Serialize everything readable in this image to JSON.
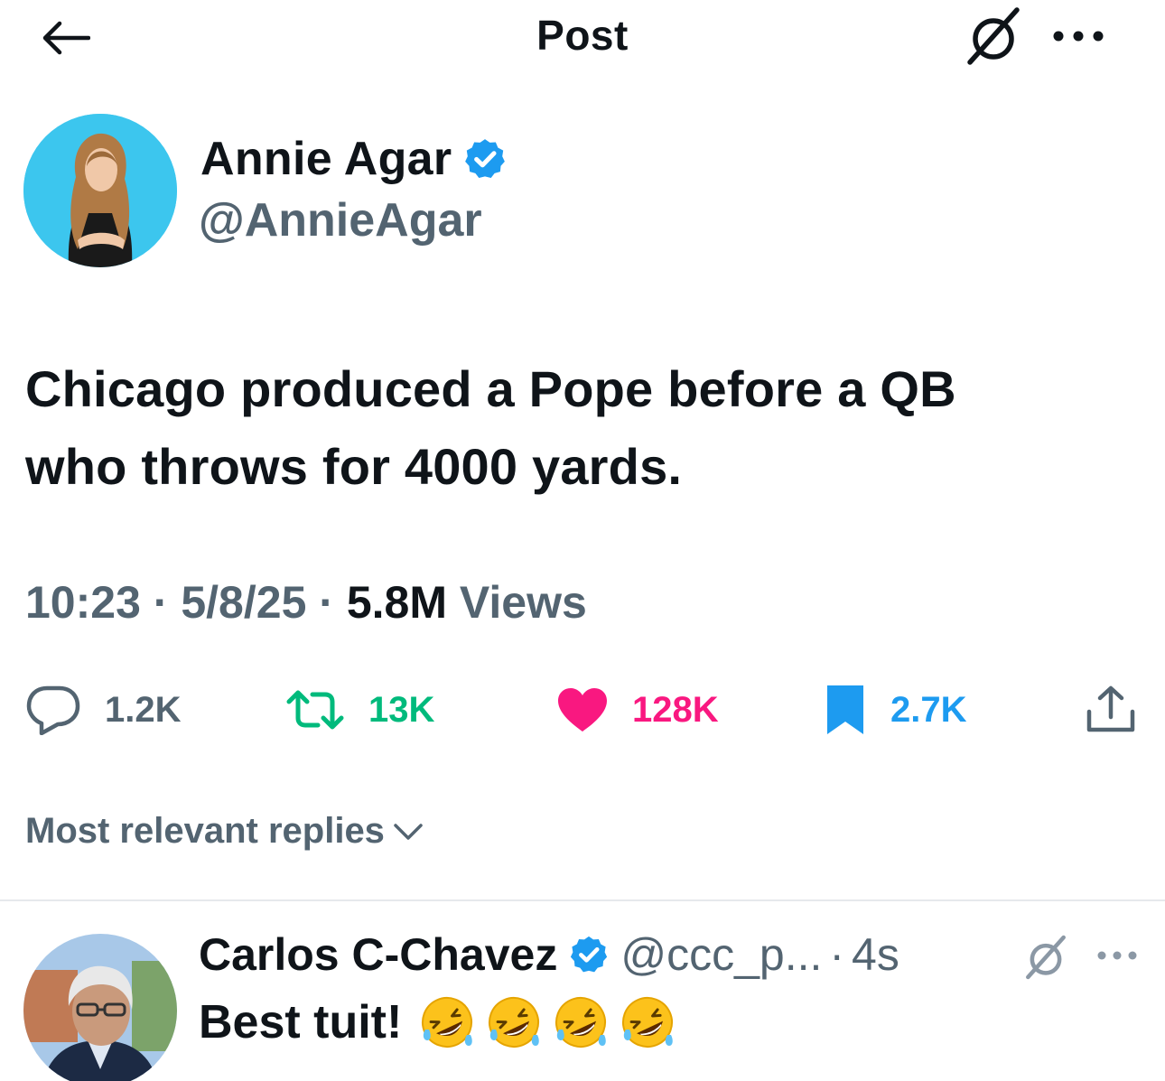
{
  "header": {
    "title": "Post",
    "back_icon": "arrow-left-icon",
    "grok_icon": "grok-icon",
    "more_icon": "more-horizontal-icon"
  },
  "post": {
    "author": {
      "name": "Annie Agar",
      "handle": "@AnnieAgar",
      "verified": true,
      "avatar_bg": "#3cc6ee"
    },
    "text_line1": "Chicago produced a Pope before a QB",
    "text_line2": "who throws for 4000 yards.",
    "time": "10:23",
    "date": "5/8/25",
    "separator": "·",
    "views_count": "5.8M",
    "views_label": "Views",
    "stats": {
      "replies": "1.2K",
      "reposts": "13K",
      "likes": "128K",
      "bookmarks": "2.7K"
    }
  },
  "replies_section": {
    "sort_label": "Most relevant replies"
  },
  "reply": {
    "name": "Carlos C-Chavez",
    "handle": "@ccc_p...",
    "separator": "·",
    "time": "4s",
    "text": "Best tuit!",
    "emoji_count": 4,
    "emoji_name": "rolling-on-the-floor-laughing"
  },
  "colors": {
    "text": "#0f1419",
    "secondary": "#536471",
    "repost": "#00ba7c",
    "like": "#f91880",
    "bookmark": "#1d9bf0",
    "verified": "#1d9bf0"
  }
}
